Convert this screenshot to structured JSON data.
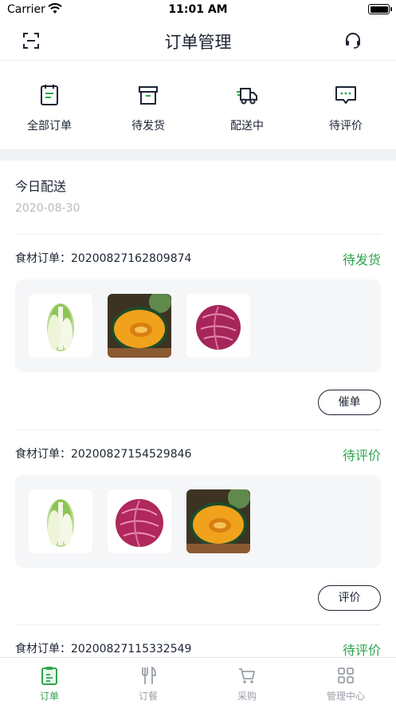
{
  "status_bar": {
    "carrier": "Carrier",
    "time": "11:01 AM"
  },
  "nav": {
    "title": "订单管理",
    "left_icon": "scan-icon",
    "right_icon": "headset-icon"
  },
  "status_tabs": [
    {
      "label": "全部订单",
      "icon": "clipboard-icon"
    },
    {
      "label": "待发货",
      "icon": "box-icon"
    },
    {
      "label": "配送中",
      "icon": "truck-icon"
    },
    {
      "label": "待评价",
      "icon": "comment-icon"
    }
  ],
  "section": {
    "title": "今日配送",
    "date": "2020-08-30"
  },
  "orders": [
    {
      "id_text": "食材订单：20200827162809874",
      "status": "待发货",
      "button": "催单",
      "items": [
        "cabbage",
        "pumpkin",
        "red-cabbage"
      ]
    },
    {
      "id_text": "食材订单：20200827154529846",
      "status": "待评价",
      "button": "评价",
      "items": [
        "cabbage",
        "red-cabbage",
        "pumpkin"
      ]
    },
    {
      "id_text": "食材订单：20200827115332549",
      "status": "待评价"
    }
  ],
  "tab_bar": [
    {
      "label": "订单",
      "icon": "order-icon",
      "active": true
    },
    {
      "label": "订餐",
      "icon": "fork-knife-icon",
      "active": false
    },
    {
      "label": "采购",
      "icon": "cart-icon",
      "active": false
    },
    {
      "label": "管理中心",
      "icon": "grid-icon",
      "active": false
    }
  ],
  "colors": {
    "accent": "#2ea44f",
    "text": "#1c2533",
    "muted": "#b5b9c0",
    "panel": "#f5f6f8"
  }
}
